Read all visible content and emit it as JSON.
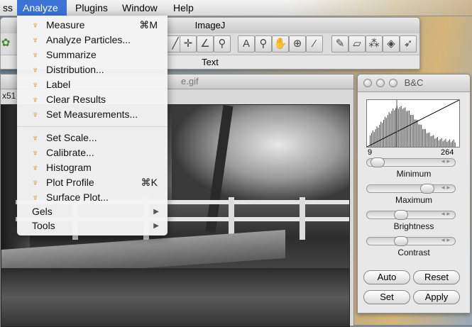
{
  "menubar": {
    "items": [
      {
        "label": "ss"
      },
      {
        "label": "Analyze"
      },
      {
        "label": "Plugins"
      },
      {
        "label": "Window"
      },
      {
        "label": "Help"
      }
    ]
  },
  "toolbar_window": {
    "title": "ImageJ",
    "status": "Text"
  },
  "image_window": {
    "title": "e.gif",
    "info": "x51"
  },
  "bc_window": {
    "title": "B&C",
    "hist_min": "9",
    "hist_max": "264",
    "sliders": {
      "minimum": {
        "label": "Minimum",
        "level": 0.05
      },
      "maximum": {
        "label": "Maximum",
        "level": 0.8
      },
      "brightness": {
        "label": "Brightness",
        "level": 0.4
      },
      "contrast": {
        "label": "Contrast",
        "level": 0.4
      }
    },
    "buttons": {
      "auto": "Auto",
      "reset": "Reset",
      "set": "Set",
      "apply": "Apply"
    }
  },
  "analyze_menu": {
    "items": [
      {
        "label": "Measure",
        "shortcut": "⌘M"
      },
      {
        "label": "Analyze Particles..."
      },
      {
        "label": "Summarize"
      },
      {
        "label": "Distribution..."
      },
      {
        "label": "Label"
      },
      {
        "label": "Clear Results"
      },
      {
        "label": "Set Measurements..."
      },
      {
        "label": "Set Scale..."
      },
      {
        "label": "Calibrate..."
      },
      {
        "label": "Histogram"
      },
      {
        "label": "Plot Profile",
        "shortcut": "⌘K"
      },
      {
        "label": "Surface Plot..."
      },
      {
        "label": "Gels"
      },
      {
        "label": "Tools"
      }
    ]
  }
}
